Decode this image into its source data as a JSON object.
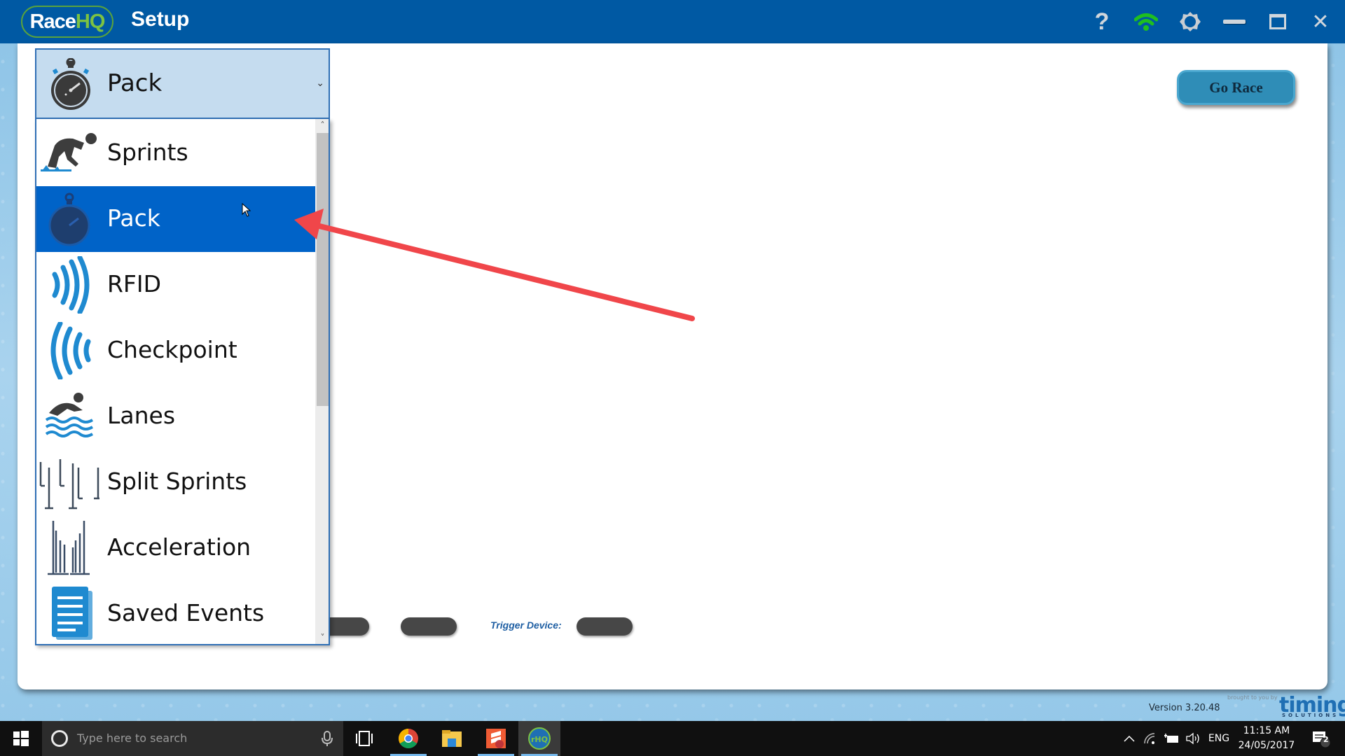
{
  "app": {
    "logo_race": "Race",
    "logo_hq": "HQ",
    "title": "Setup"
  },
  "titlebar_icons": [
    {
      "name": "help-icon",
      "glyph": "?"
    },
    {
      "name": "wifi-connected-icon",
      "color": "#1fbf1f"
    },
    {
      "name": "settings-gear-icon"
    },
    {
      "name": "minimize-icon"
    },
    {
      "name": "maximize-icon"
    },
    {
      "name": "close-icon",
      "glyph": "✕"
    }
  ],
  "event_type_dropdown": {
    "selected": "Pack",
    "chevron": "⌄",
    "options": [
      {
        "label": "Sprints",
        "icon": "sprinter-icon"
      },
      {
        "label": "Pack",
        "icon": "stopwatch-icon",
        "highlighted": true
      },
      {
        "label": "RFID",
        "icon": "rfid-signal-icon"
      },
      {
        "label": "Checkpoint",
        "icon": "checkpoint-signal-icon"
      },
      {
        "label": "Lanes",
        "icon": "swimmer-icon"
      },
      {
        "label": "Split Sprints",
        "icon": "split-gates-icon"
      },
      {
        "label": "Acceleration",
        "icon": "acceleration-gates-icon"
      },
      {
        "label": "Saved Events",
        "icon": "saved-document-icon"
      }
    ],
    "scroll_up": "˄",
    "scroll_down": "˅"
  },
  "go_race_label": "Go Race",
  "trigger_device_label": "Trigger Device:",
  "footer": {
    "version": "Version 3.20.48",
    "brought_by": "brought to you by",
    "brand": "timing",
    "brand_sub": "SOLUTIONS"
  },
  "colors": {
    "titlebar": "#0059a3",
    "selected_item": "#0063c8",
    "accent_blue": "#1f8ad0",
    "go_race": "#2f8db7",
    "annotation_arrow": "#f0464a"
  },
  "taskbar": {
    "search_placeholder": "Type here to search",
    "apps": [
      "task-view",
      "chrome",
      "file-explorer",
      "sublime-text",
      "racehq"
    ],
    "tray": {
      "language": "ENG",
      "time": "11:15 AM",
      "date": "24/05/2017",
      "notification_count": "2"
    }
  }
}
